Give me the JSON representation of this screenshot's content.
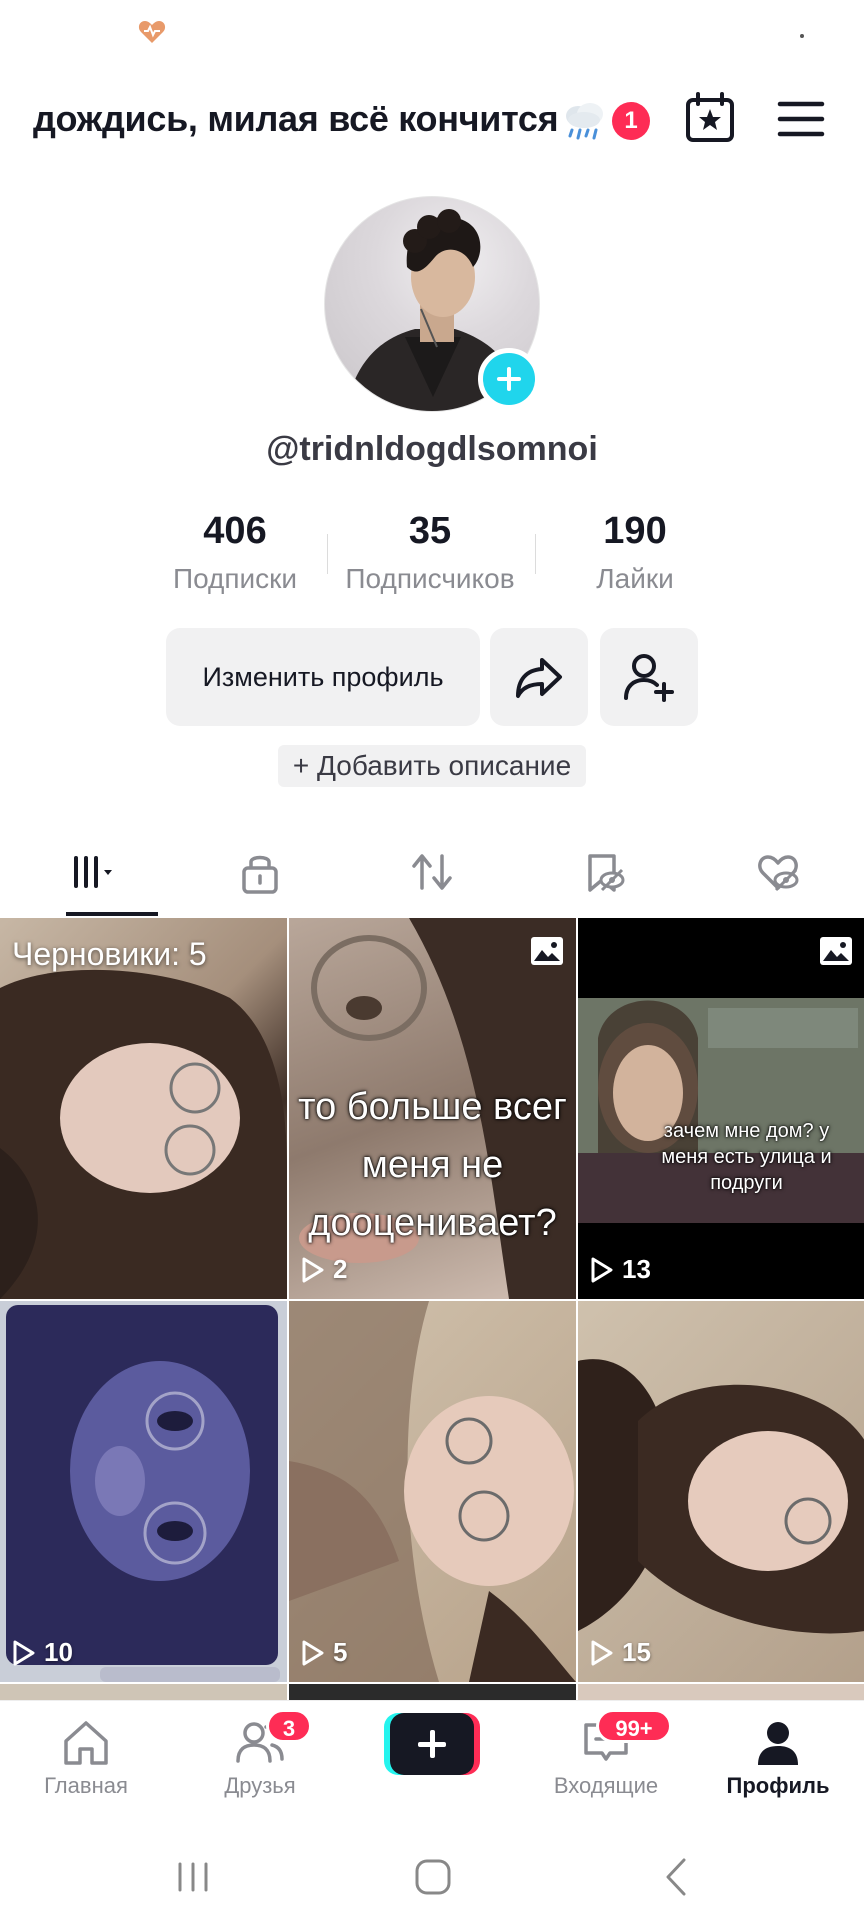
{
  "header": {
    "title": "дождись, милая всё кончится",
    "notification_count": "1"
  },
  "profile": {
    "username": "@tridnldogdlsomnoi",
    "stats": [
      {
        "value": "406",
        "label": "Подписки"
      },
      {
        "value": "35",
        "label": "Подписчиков"
      },
      {
        "value": "190",
        "label": "Лайки"
      }
    ],
    "edit_label": "Изменить профиль",
    "add_description": "+ Добавить описание"
  },
  "tabs": [
    "videos-grid",
    "private",
    "reposts",
    "favorites",
    "liked-hidden"
  ],
  "grid": {
    "drafts_label": "Черновики: 5",
    "items": [
      {
        "views": "",
        "overlay": ""
      },
      {
        "views": "2",
        "overlay_lines": [
          "то больше всег",
          "меня не",
          "дооценивает?"
        ]
      },
      {
        "views": "13",
        "overlay_lines": [
          "зачем мне дом? у",
          "меня есть улица и",
          "подруги"
        ]
      },
      {
        "views": "10"
      },
      {
        "views": "5"
      },
      {
        "views": "15"
      }
    ]
  },
  "bottom_nav": {
    "home": "Главная",
    "friends": "Друзья",
    "friends_badge": "3",
    "inbox": "Входящие",
    "inbox_badge": "99+",
    "profile": "Профиль"
  },
  "colors": {
    "accent": "#fe2c55",
    "cyan": "#25f4ee",
    "avatar_plus": "#20d5ec",
    "text": "#161823",
    "muted": "#8a8b91"
  }
}
